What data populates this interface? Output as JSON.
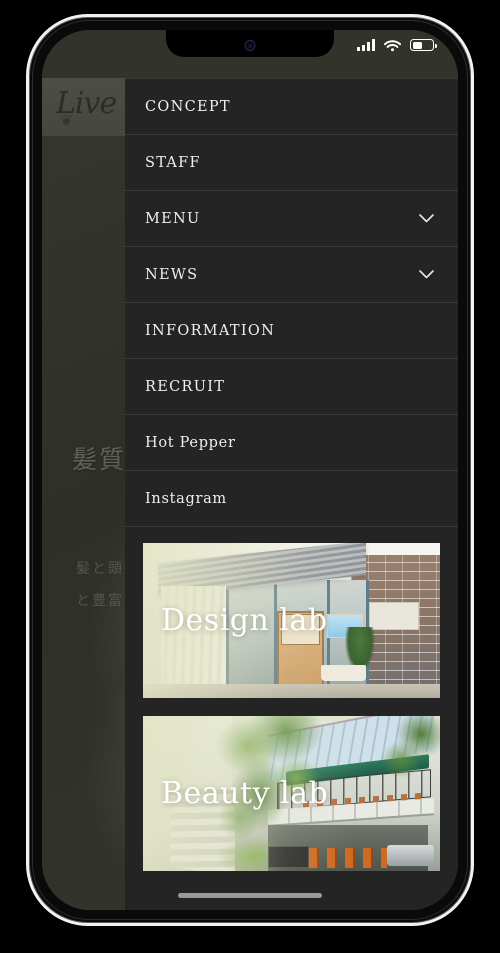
{
  "device": {
    "status_bar": {
      "signal_icon": "cellular-signal-icon",
      "signal_bars": 4,
      "wifi_icon": "wifi-icon",
      "battery_icon": "battery-icon",
      "battery_level_percent": 50
    },
    "home_indicator": "home-indicator"
  },
  "background_page": {
    "logo_text": "Live",
    "logo_flourish": "❦",
    "hero_title": "髪質で",
    "hero_sub_line1": "髪と頭皮",
    "hero_sub_line2": "と豊富な"
  },
  "drawer": {
    "menu": [
      {
        "label": "CONCEPT",
        "style": "upper",
        "has_submenu": false
      },
      {
        "label": "STAFF",
        "style": "upper",
        "has_submenu": false
      },
      {
        "label": "MENU",
        "style": "upper",
        "has_submenu": true
      },
      {
        "label": "NEWS",
        "style": "upper",
        "has_submenu": true
      },
      {
        "label": "INFORMATION",
        "style": "upper",
        "has_submenu": false
      },
      {
        "label": "RECRUIT",
        "style": "upper",
        "has_submenu": false
      },
      {
        "label": "Hot Pepper",
        "style": "mixed",
        "has_submenu": false
      },
      {
        "label": "Instagram",
        "style": "mixed",
        "has_submenu": false
      }
    ],
    "chevron_icon": "chevron-down-icon",
    "cards": [
      {
        "label": "Design lab",
        "image": "storefront-design-lab-photo"
      },
      {
        "label": "Beauty lab",
        "image": "building-beauty-lab-photo"
      }
    ]
  },
  "colors": {
    "drawer_bg": "#242424",
    "drawer_divider": "#3a3a3a",
    "menu_text": "#f0efe9",
    "card_label": "#ffffff",
    "device_frame": "#f2f2f2",
    "page_overlay": "rgba(20,22,16,0.52)"
  }
}
